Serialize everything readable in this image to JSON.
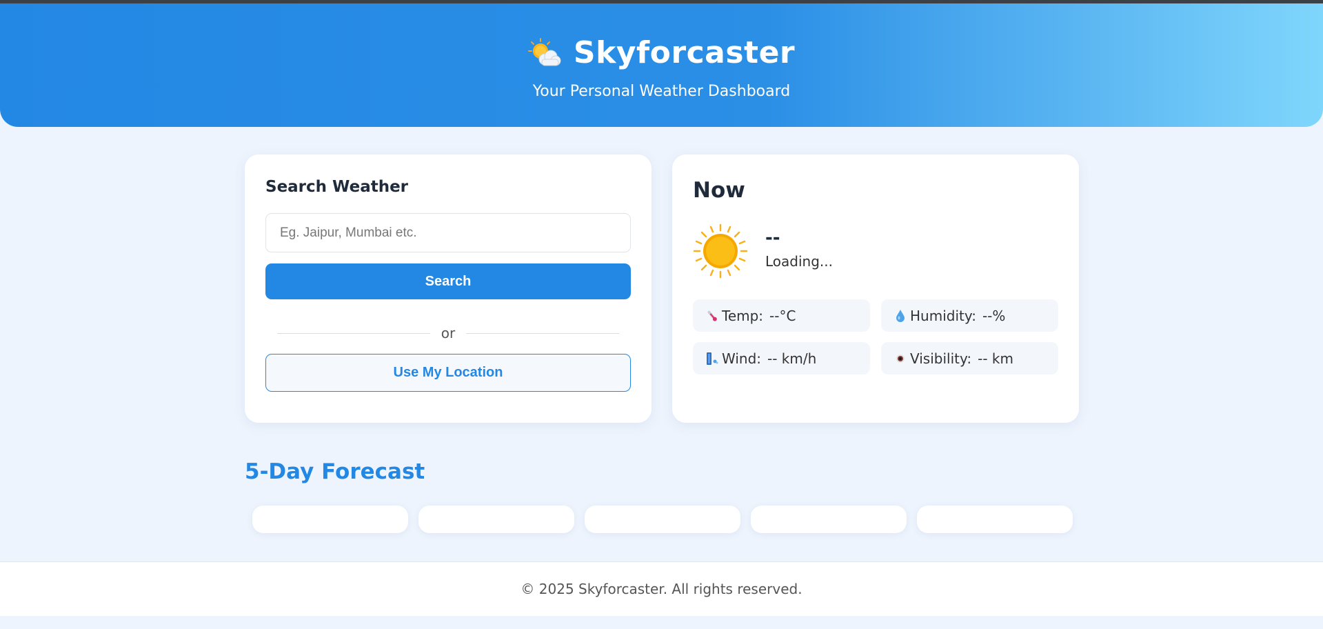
{
  "header": {
    "app_name": "Skyforcaster",
    "tagline": "Your Personal Weather Dashboard",
    "logo_icon": "sun-behind-cloud-icon"
  },
  "search": {
    "title": "Search Weather",
    "placeholder": "Eg. Jaipur, Mumbai etc.",
    "value": "",
    "button_label": "Search",
    "divider_text": "or",
    "location_button_label": "Use My Location"
  },
  "now": {
    "title": "Now",
    "icon": "sun-icon",
    "temperature": "--",
    "description": "Loading...",
    "stats": [
      {
        "icon": "thermometer-icon",
        "label": "Temp:",
        "value": "--°C"
      },
      {
        "icon": "droplet-icon",
        "label": "Humidity:",
        "value": "--%"
      },
      {
        "icon": "wind-icon",
        "label": "Wind:",
        "value": "-- km/h"
      },
      {
        "icon": "eye-icon",
        "label": "Visibility:",
        "value": "-- km"
      }
    ]
  },
  "forecast": {
    "title": "5-Day Forecast",
    "days": [
      "",
      "",
      "",
      "",
      ""
    ]
  },
  "footer": {
    "text": "© 2025 Skyforcaster. All rights reserved."
  },
  "colors": {
    "accent": "#2388e4",
    "page_background": "#eef4fd",
    "header_gradient_end": "#7fd6fc"
  }
}
